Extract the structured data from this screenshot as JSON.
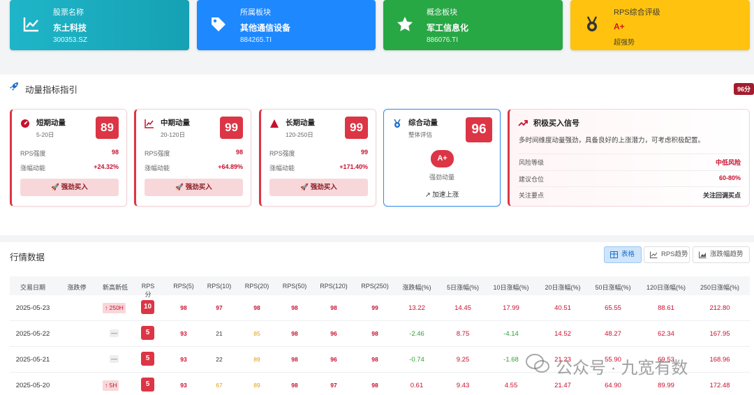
{
  "top_cards": [
    {
      "label": "股票名称",
      "value": "东土科技",
      "code": "300353.SZ",
      "icon": "chart-line-icon"
    },
    {
      "label": "所属板块",
      "value": "其他通信设备",
      "code": "884265.TI",
      "icon": "tag-icon"
    },
    {
      "label": "概念板块",
      "value": "军工信息化",
      "code": "886076.TI",
      "icon": "star-icon"
    },
    {
      "label": "RPS综合评级",
      "value": "A+",
      "code": "超强势",
      "icon": "medal-icon"
    }
  ],
  "momentum": {
    "title": "动量指标指引",
    "score_badge": "96分",
    "cards": [
      {
        "name": "短期动量",
        "range": "5-20日",
        "score": "89",
        "rps_label": "RPS强度",
        "rps": "98",
        "gain_label": "涨幅动能",
        "gain": "+24.32%",
        "button": "强劲买入",
        "icon": "gauge-icon"
      },
      {
        "name": "中期动量",
        "range": "20-120日",
        "score": "99",
        "rps_label": "RPS强度",
        "rps": "98",
        "gain_label": "涨幅动能",
        "gain": "+64.89%",
        "button": "强劲买入",
        "icon": "chart-line-icon"
      },
      {
        "name": "长期动量",
        "range": "120-250日",
        "score": "99",
        "rps_label": "RPS强度",
        "rps": "99",
        "gain_label": "涨幅动能",
        "gain": "+171.40%",
        "button": "强劲买入",
        "icon": "mountain-icon"
      }
    ],
    "overall": {
      "name": "综合动量",
      "sub": "整体评估",
      "score": "96",
      "grade": "A+",
      "grade_label": "强劲动量",
      "trend": "加速上涨",
      "icon": "medal-icon"
    },
    "signal": {
      "title": "积极买入信号",
      "desc": "多时间维度动量强劲，具备良好的上涨潜力，可考虑积极配置。",
      "rows": [
        {
          "label": "风险等级",
          "value": "中低风险",
          "color": "#c8102e"
        },
        {
          "label": "建议仓位",
          "value": "60-80%",
          "color": "#c8102e"
        },
        {
          "label": "关注要点",
          "value": "关注回调买点",
          "color": "#333333"
        }
      ]
    }
  },
  "market": {
    "title": "行情数据",
    "views": [
      "表格",
      "RPS趋势",
      "涨跌幅趋势"
    ],
    "headers": [
      "交易日期",
      "涨跌停",
      "新高新低",
      "RPS分",
      "RPS(5)",
      "RPS(10)",
      "RPS(20)",
      "RPS(50)",
      "RPS(120)",
      "RPS(250)",
      "涨跌幅(%)",
      "5日涨幅(%)",
      "10日涨幅(%)",
      "20日涨幅(%)",
      "50日涨幅(%)",
      "120日涨幅(%)",
      "250日涨幅(%)"
    ],
    "rows": [
      {
        "date": "2025-05-23",
        "limit": "",
        "high": "↑ 250H",
        "rps": "10",
        "r5": "98",
        "r10": "97",
        "r20": "98",
        "r50": "98",
        "r120": "98",
        "r250": "99",
        "chg": "13.22",
        "c5": "14.45",
        "c10": "17.99",
        "c20": "40.51",
        "c50": "65.55",
        "c120": "88.61",
        "c250": "212.80"
      },
      {
        "date": "2025-05-22",
        "limit": "",
        "high": "—",
        "rps": "5",
        "r5": "93",
        "r10": "21",
        "r20": "85",
        "r50": "98",
        "r120": "96",
        "r250": "98",
        "chg": "-2.46",
        "c5": "8.75",
        "c10": "-4.14",
        "c20": "14.52",
        "c50": "48.27",
        "c120": "62.34",
        "c250": "167.95"
      },
      {
        "date": "2025-05-21",
        "limit": "",
        "high": "—",
        "rps": "5",
        "r5": "93",
        "r10": "22",
        "r20": "89",
        "r50": "98",
        "r120": "96",
        "r250": "98",
        "chg": "-0.74",
        "c5": "9.25",
        "c10": "-1.68",
        "c20": "21.23",
        "c50": "55.90",
        "c120": "69.53",
        "c250": "168.96"
      },
      {
        "date": "2025-05-20",
        "limit": "",
        "high": "↑ 5H",
        "rps": "5",
        "r5": "93",
        "r10": "67",
        "r20": "89",
        "r50": "98",
        "r120": "97",
        "r250": "98",
        "chg": "0.61",
        "c5": "9.43",
        "c10": "4.55",
        "c20": "21.47",
        "c50": "64.90",
        "c120": "89.99",
        "c250": "172.48"
      }
    ]
  },
  "watermark": "公众号 · 九宽有数",
  "colors": {
    "red": "#dc3545",
    "blue": "#1e88ff",
    "teal": "#16a1b4",
    "green": "#28a745",
    "yellow": "#ffc30f"
  }
}
